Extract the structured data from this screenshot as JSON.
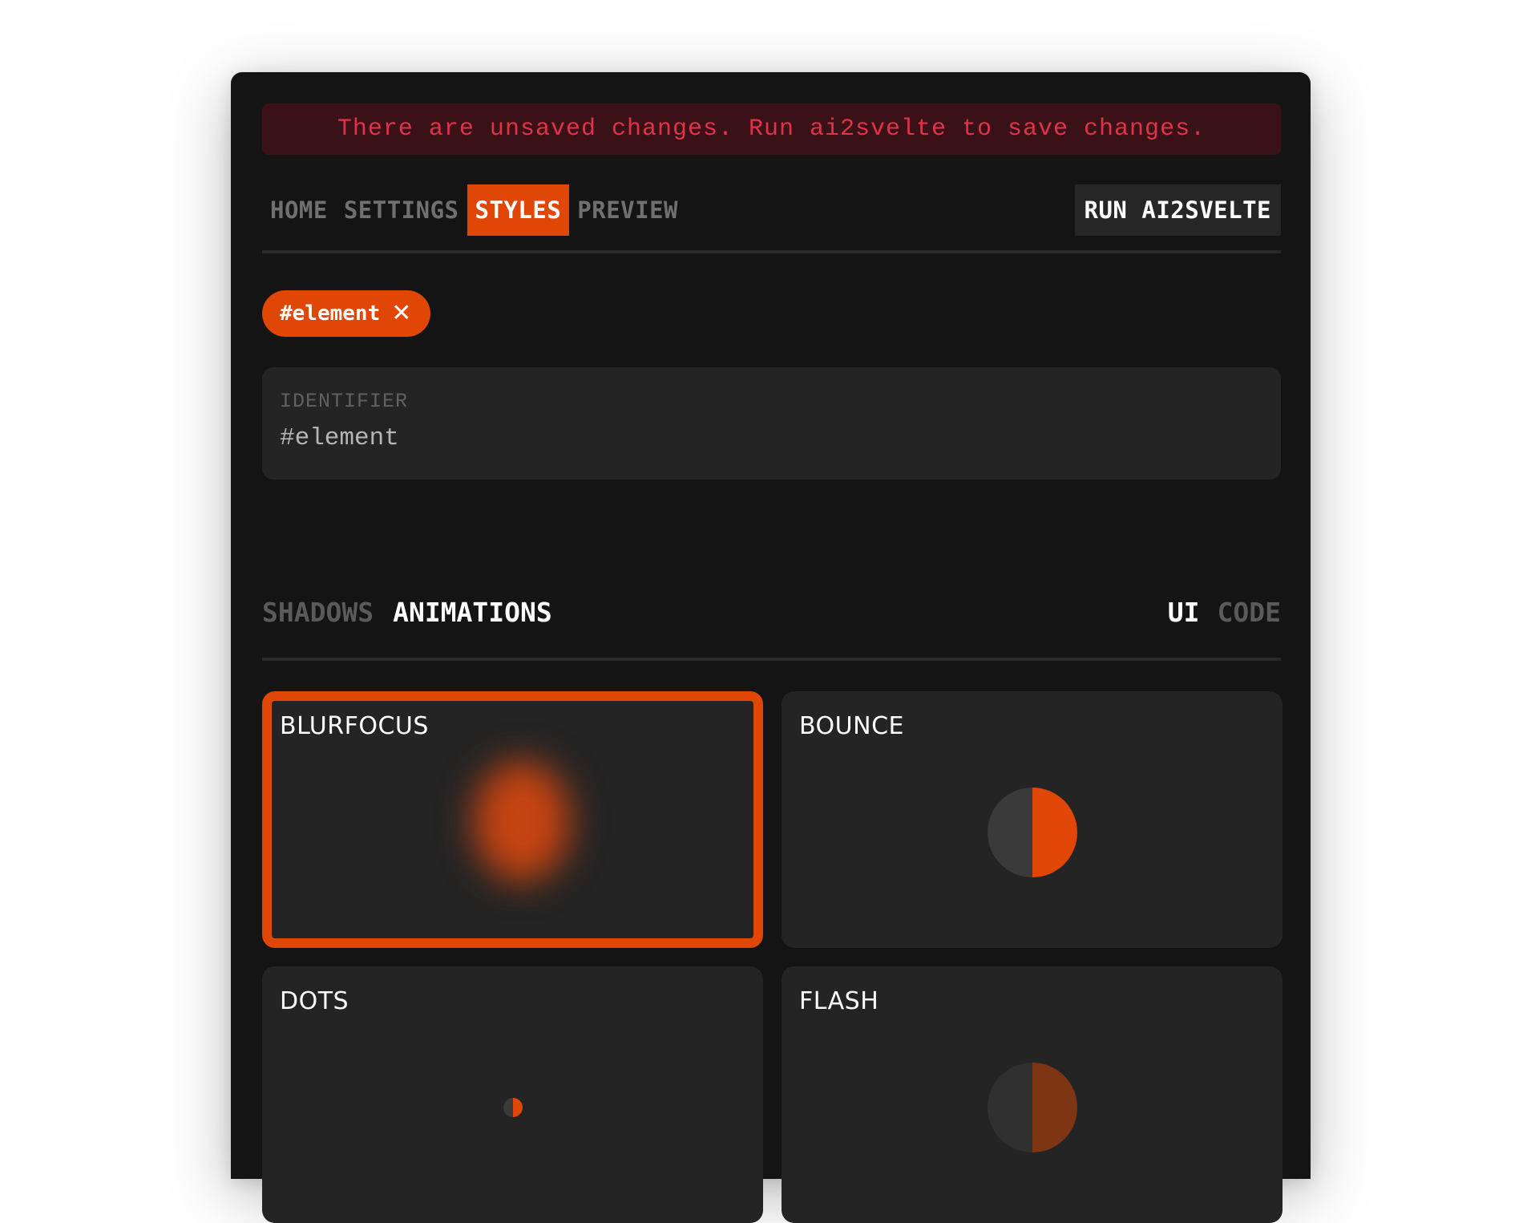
{
  "banner": {
    "text": "There are unsaved changes. Run ai2svelte to save changes."
  },
  "nav": {
    "items": [
      "HOME",
      "SETTINGS",
      "STYLES",
      "PREVIEW"
    ],
    "active": "STYLES",
    "run_label": "RUN AI2SVELTE"
  },
  "chip": {
    "label": "#element",
    "close_icon": "close-icon"
  },
  "identifier": {
    "label": "IDENTIFIER",
    "value": "#element"
  },
  "subnav": {
    "left": [
      "SHADOWS",
      "ANIMATIONS"
    ],
    "active_left": "ANIMATIONS",
    "right": [
      "UI",
      "CODE"
    ],
    "active_right": "UI"
  },
  "animations": [
    {
      "name": "BLURFOCUS",
      "selected": true
    },
    {
      "name": "BOUNCE",
      "selected": false
    },
    {
      "name": "DOTS",
      "selected": false
    },
    {
      "name": "FLASH",
      "selected": false
    }
  ],
  "colors": {
    "accent": "#e04707",
    "background": "#141414",
    "card": "#242424",
    "banner_bg": "#3a1116",
    "banner_text": "#e0334a"
  }
}
